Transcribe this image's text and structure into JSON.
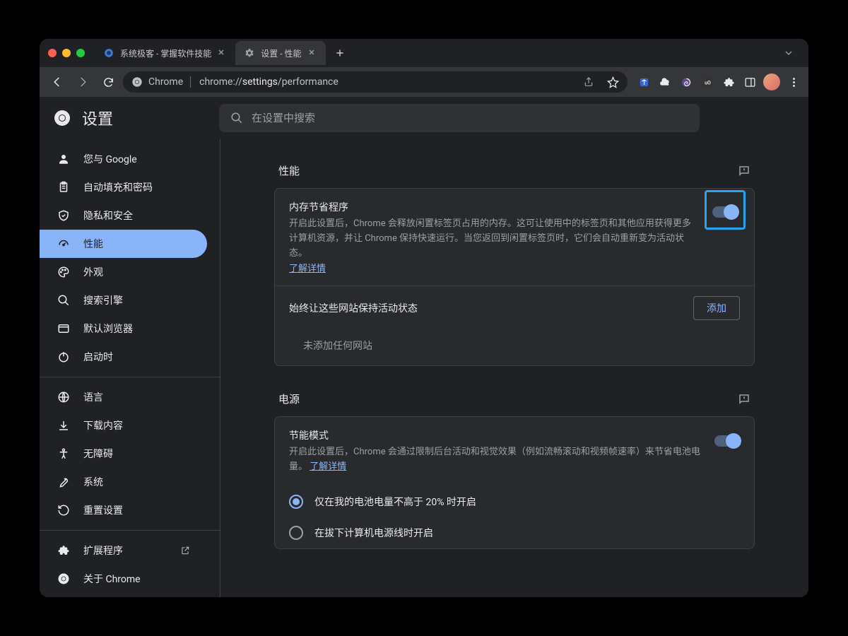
{
  "tabs": [
    {
      "title": "系统极客 - 掌握软件技能"
    },
    {
      "title": "设置 - 性能"
    }
  ],
  "toolbar": {
    "chip": "Chrome",
    "url_prefix": "chrome://",
    "url_strong": "settings",
    "url_suffix": "/performance"
  },
  "header": {
    "title": "设置",
    "search_placeholder": "在设置中搜索"
  },
  "sidebar": {
    "items_a": [
      {
        "label": "您与 Google"
      },
      {
        "label": "自动填充和密码"
      },
      {
        "label": "隐私和安全"
      },
      {
        "label": "性能"
      },
      {
        "label": "外观"
      },
      {
        "label": "搜索引擎"
      },
      {
        "label": "默认浏览器"
      },
      {
        "label": "启动时"
      }
    ],
    "items_b": [
      {
        "label": "语言"
      },
      {
        "label": "下载内容"
      },
      {
        "label": "无障碍"
      },
      {
        "label": "系统"
      },
      {
        "label": "重置设置"
      }
    ],
    "items_c": [
      {
        "label": "扩展程序"
      },
      {
        "label": "关于 Chrome"
      }
    ]
  },
  "sections": {
    "performance": {
      "title": "性能",
      "memory_saver": {
        "title": "内存节省程序",
        "desc": "开启此设置后，Chrome 会释放闲置标签页占用的内存。这可让使用中的标签页和其他应用获得更多计算机资源，并让 Chrome 保持快速运行。当您返回到闲置标签页时，它们会自动重新变为活动状态。",
        "learn_more": "了解详情"
      },
      "always_active": {
        "title": "始终让这些网站保持活动状态",
        "add_button": "添加",
        "empty": "未添加任何网站"
      }
    },
    "power": {
      "title": "电源",
      "energy_saver": {
        "title": "节能模式",
        "desc": "开启此设置后，Chrome 会通过限制后台活动和视觉效果（例如流畅滚动和视频帧速率）来节省电池电量。",
        "learn_more": "了解详情"
      },
      "radio1": "仅在我的电池电量不高于 20% 时开启",
      "radio2": "在拔下计算机电源线时开启"
    }
  }
}
